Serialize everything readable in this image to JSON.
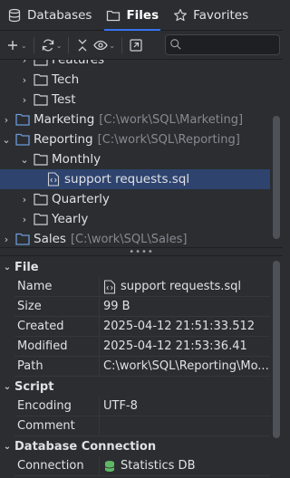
{
  "tabs": [
    {
      "label": "Databases",
      "icon": "database-icon",
      "active": false
    },
    {
      "label": "Files",
      "icon": "folder-icon",
      "active": true
    },
    {
      "label": "Favorites",
      "icon": "star-icon",
      "active": false
    }
  ],
  "toolbar": {
    "buttons": [
      "add-icon",
      "refresh-icon",
      "collapse-icon",
      "eye-icon",
      "navigate-icon"
    ],
    "search_value": ""
  },
  "tree": {
    "rows": [
      {
        "label": "Features",
        "path": "",
        "kind": "folder",
        "expanded": false
      },
      {
        "label": "Tech",
        "path": "",
        "kind": "folder",
        "expanded": false
      },
      {
        "label": "Test",
        "path": "",
        "kind": "folder",
        "expanded": false
      },
      {
        "label": "Marketing",
        "path": "[C:\\work\\SQL\\Marketing]",
        "kind": "root-folder",
        "expanded": false
      },
      {
        "label": "Reporting",
        "path": "[C:\\work\\SQL\\Reporting]",
        "kind": "root-folder",
        "expanded": true
      },
      {
        "label": "Monthly",
        "path": "",
        "kind": "folder",
        "expanded": true
      },
      {
        "label": "support requests.sql",
        "path": "",
        "kind": "file",
        "selected": true
      },
      {
        "label": "Quarterly",
        "path": "",
        "kind": "folder",
        "expanded": false
      },
      {
        "label": "Yearly",
        "path": "",
        "kind": "folder",
        "expanded": false
      },
      {
        "label": "Sales",
        "path": "[C:\\work\\SQL\\Sales]",
        "kind": "root-folder",
        "expanded": false
      }
    ],
    "splitter_glyph": "••••"
  },
  "properties": {
    "file": {
      "title": "File",
      "rows": [
        {
          "name": "Name",
          "value": "support requests.sql"
        },
        {
          "name": "Size",
          "value": "99 B"
        },
        {
          "name": "Created",
          "value": "2025-04-12 21:51:33.512"
        },
        {
          "name": "Modified",
          "value": "2025-04-12 21:53:36.41"
        },
        {
          "name": "Path",
          "value": "C:\\work\\SQL\\Reporting\\Mo..."
        }
      ]
    },
    "script": {
      "title": "Script",
      "rows": [
        {
          "name": "Encoding",
          "value": "UTF-8"
        },
        {
          "name": "Comment",
          "value": ""
        }
      ]
    },
    "connection": {
      "title": "Database Connection",
      "rows": [
        {
          "name": "Connection",
          "value": "Statistics DB"
        }
      ]
    }
  },
  "colors": {
    "background": "#2b2d30",
    "accent": "#3574f0",
    "selection": "#2e436e",
    "muted_text": "#868a91",
    "folder_stroke": "#ced0d6",
    "root_folder": "#6e9bd8",
    "db_green": "#5fb865"
  }
}
